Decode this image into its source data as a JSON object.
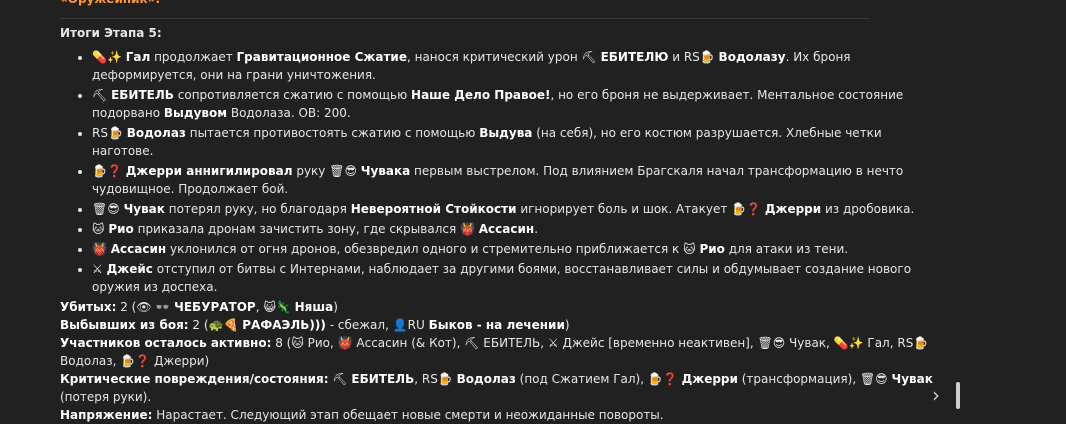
{
  "top_label": "«Оружейник».",
  "section_title": "Итоги Этапа 5:",
  "items": [
    [
      {
        "t": "💊✨ "
      },
      {
        "b": "Гал"
      },
      {
        "t": " продолжает "
      },
      {
        "b": "Гравитационное Сжатие"
      },
      {
        "t": ", нанося критический урон ⛏ "
      },
      {
        "b": "ЕБИТЕЛЮ"
      },
      {
        "t": " и RS🍺 "
      },
      {
        "b": "Водолазу"
      },
      {
        "t": ". Их броня деформируется, они на грани уничтожения."
      }
    ],
    [
      {
        "t": "⛏ "
      },
      {
        "b": "ЕБИТЕЛЬ"
      },
      {
        "t": " сопротивляется сжатию с помощью "
      },
      {
        "b": "Наше Дело Правое!"
      },
      {
        "t": ", но его броня не выдерживает. Ментальное состояние подорвано "
      },
      {
        "b": "Выдувом"
      },
      {
        "t": " Водолаза. ОВ: 200."
      }
    ],
    [
      {
        "t": "RS🍺 "
      },
      {
        "b": "Водолаз"
      },
      {
        "t": " пытается противостоять сжатию с помощью "
      },
      {
        "b": "Выдува"
      },
      {
        "t": " (на себя), но его костюм разрушается. Хлебные четки наготове."
      }
    ],
    [
      {
        "t": "🍺❓ "
      },
      {
        "b": "Джерри аннигилировал"
      },
      {
        "t": " руку 🗑😎 "
      },
      {
        "b": "Чувака"
      },
      {
        "t": " первым выстрелом. Под влиянием Брагскаля начал трансформацию в нечто чудовищное. Продолжает бой."
      }
    ],
    [
      {
        "t": "🗑😎 "
      },
      {
        "b": "Чувак"
      },
      {
        "t": " потерял руку, но благодаря "
      },
      {
        "b": "Невероятной Стойкости"
      },
      {
        "t": " игнорирует боль и шок. Атакует 🍺❓ "
      },
      {
        "b": "Джерри"
      },
      {
        "t": " из дробовика."
      }
    ],
    [
      {
        "t": "🐱 "
      },
      {
        "b": "Рио"
      },
      {
        "t": " приказала дронам зачистить зону, где скрывался 👹 "
      },
      {
        "b": "Ассасин"
      },
      {
        "t": "."
      }
    ],
    [
      {
        "t": "👹 "
      },
      {
        "b": "Ассасин"
      },
      {
        "t": " уклонился от огня дронов, обезвредил одного и стремительно приближается к 🐱 "
      },
      {
        "b": "Рио"
      },
      {
        "t": " для атаки из тени."
      }
    ],
    [
      {
        "t": "⚔ "
      },
      {
        "b": "Джейс"
      },
      {
        "t": " отступил от битвы с Интернами, наблюдает за другими боями, восстанавливает силы и обдумывает создание нового оружия из доспеха."
      }
    ]
  ],
  "summary": [
    [
      {
        "b": "Убитых:"
      },
      {
        "t": " 2 ("
      },
      {
        "t": "👁 👓 "
      },
      {
        "b": "ЧЕБУРАТОР"
      },
      {
        "t": ", 😺🦎 "
      },
      {
        "b": "Няша"
      },
      {
        "t": ")"
      }
    ],
    [
      {
        "b": "Выбывших из боя:"
      },
      {
        "t": " 2 (🐢🍕 "
      },
      {
        "b": "РАФАЭЛЬ)))"
      },
      {
        "t": " - сбежал, 👤RU "
      },
      {
        "b": "Быков - на лечении"
      },
      {
        "t": ")"
      }
    ],
    [
      {
        "b": "Участников осталось активно:"
      },
      {
        "t": " 8 (🐱 Рио, 👹 Ассасин (& Кот), ⛏ ЕБИТЕЛЬ, ⚔ Джейс [временно неактивен], 🗑😎 Чувак, 💊✨ Гал, RS🍺 Водолаз, 🍺❓ Джерри)"
      }
    ],
    [
      {
        "b": "Критические повреждения/состояния:"
      },
      {
        "t": " ⛏ "
      },
      {
        "b": "ЕБИТЕЛЬ"
      },
      {
        "t": ", RS🍺 "
      },
      {
        "b": "Водолаз"
      },
      {
        "t": " (под Сжатием Гал), 🍺❓ "
      },
      {
        "b": "Джерри"
      },
      {
        "t": " (трансформация), 🗑😎 "
      },
      {
        "b": "Чувак"
      },
      {
        "t": " (потеря руки)."
      }
    ],
    [
      {
        "b": "Напряжение:"
      },
      {
        "t": " Нарастает. Следующий этап обещает новые смерти и неожиданные повороты."
      }
    ]
  ],
  "icons": {
    "chevron": "chevron-right-icon"
  }
}
